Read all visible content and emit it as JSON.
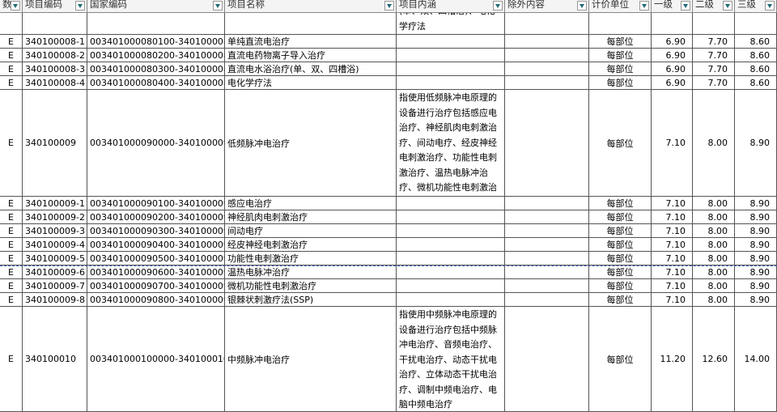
{
  "header": {
    "col0": "数",
    "col1": "项目编码",
    "col2": "国家编码",
    "col3": "项目名称",
    "col4": "项目内涵",
    "col5": "除外内容",
    "col6": "计价单位",
    "col7": "一级",
    "col8": "二级",
    "col9": "三级"
  },
  "top_partial": {
    "content": "(单、双、四槽浴)、电化学疗法"
  },
  "rows": [
    {
      "type": "E",
      "code": "340100008-1",
      "ncode": "003401000080100-340100008-1",
      "name": "单纯直流电治疗",
      "content": "",
      "unit": "每部位",
      "p1": "6.90",
      "p2": "7.70",
      "p3": "8.60"
    },
    {
      "type": "E",
      "code": "340100008-2",
      "ncode": "003401000080200-340100008-2",
      "name": "直流电药物离子导入治疗",
      "content": "",
      "unit": "每部位",
      "p1": "6.90",
      "p2": "7.70",
      "p3": "8.60"
    },
    {
      "type": "E",
      "code": "340100008-3",
      "ncode": "003401000080300-340100008-3",
      "name": "直流电水浴治疗(单、双、四槽浴)",
      "content": "",
      "unit": "每部位",
      "p1": "6.90",
      "p2": "7.70",
      "p3": "8.60"
    },
    {
      "type": "E",
      "code": "340100008-4",
      "ncode": "003401000080400-340100008-4",
      "name": "电化学疗法",
      "content": "",
      "unit": "每部位",
      "p1": "6.90",
      "p2": "7.70",
      "p3": "8.60"
    },
    {
      "type": "E",
      "code": "340100009",
      "ncode": "003401000090000-340100009",
      "name": "低频脉冲电治疗",
      "content": "指使用低频脉冲电原理的设备进行治疗包括感应电治疗、神经肌肉电刺激治疗、间动电疗、经皮神经电刺激治疗、功能性电刺激治疗、温热电脉冲治疗、微机功能性电刺激治疗、银棘状刺激疗法(SSP)",
      "unit": "每部位",
      "p1": "7.10",
      "p2": "8.00",
      "p3": "8.90"
    },
    {
      "type": "E",
      "code": "340100009-1",
      "ncode": "003401000090100-340100009-1",
      "name": "感应电治疗",
      "content": "",
      "unit": "每部位",
      "p1": "7.10",
      "p2": "8.00",
      "p3": "8.90"
    },
    {
      "type": "E",
      "code": "340100009-2",
      "ncode": "003401000090200-340100009-2",
      "name": "神经肌肉电刺激治疗",
      "content": "",
      "unit": "每部位",
      "p1": "7.10",
      "p2": "8.00",
      "p3": "8.90"
    },
    {
      "type": "E",
      "code": "340100009-3",
      "ncode": "003401000090300-340100009-3",
      "name": "间动电疗",
      "content": "",
      "unit": "每部位",
      "p1": "7.10",
      "p2": "8.00",
      "p3": "8.90"
    },
    {
      "type": "E",
      "code": "340100009-4",
      "ncode": "003401000090400-340100009-4",
      "name": "经皮神经电刺激治疗",
      "content": "",
      "unit": "每部位",
      "p1": "7.10",
      "p2": "8.00",
      "p3": "8.90"
    },
    {
      "type": "E",
      "code": "340100009-5",
      "ncode": "003401000090500-340100009-5",
      "name": "功能性电刺激治疗",
      "content": "",
      "unit": "每部位",
      "p1": "7.10",
      "p2": "8.00",
      "p3": "8.90"
    },
    {
      "type": "E",
      "code": "340100009-6",
      "ncode": "003401000090600-340100009-6",
      "name": "温热电脉冲治疗",
      "content": "",
      "unit": "每部位",
      "p1": "7.10",
      "p2": "8.00",
      "p3": "8.90"
    },
    {
      "type": "E",
      "code": "340100009-7",
      "ncode": "003401000090700-340100009-7",
      "name": "微机功能性电刺激治疗",
      "content": "",
      "unit": "每部位",
      "p1": "7.10",
      "p2": "8.00",
      "p3": "8.90"
    },
    {
      "type": "E",
      "code": "340100009-8",
      "ncode": "003401000090800-340100009-8",
      "name": "银棘状刺激疗法(SSP)",
      "content": "",
      "unit": "每部位",
      "p1": "7.10",
      "p2": "8.00",
      "p3": "8.90"
    },
    {
      "type": "E",
      "code": "340100010",
      "ncode": "003401000100000-340100010",
      "name": "中频脉冲电治疗",
      "content": "指使用中频脉冲电原理的设备进行治疗包括中频脉冲电治疗、音频电治疗、干扰电治疗、动态干扰电治疗、立体动态干扰电治疗、调制中频电治疗、电脑中频电治疗",
      "unit": "每部位",
      "p1": "11.20",
      "p2": "12.60",
      "p3": "14.00"
    }
  ]
}
